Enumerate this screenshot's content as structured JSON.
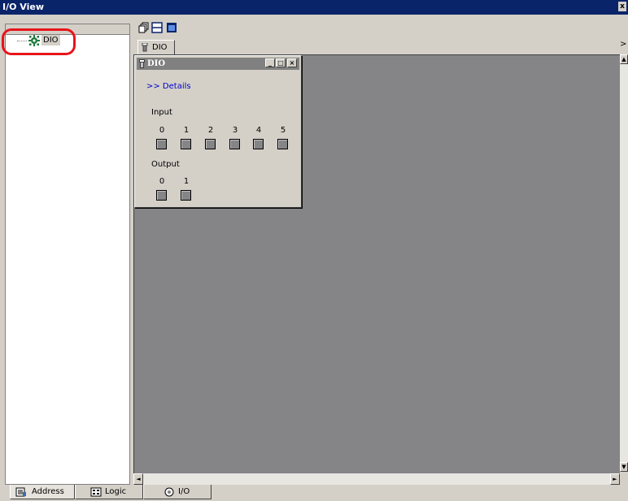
{
  "window": {
    "title": "I/O View",
    "close_glyph": "x"
  },
  "tree": {
    "node_label": "DIO",
    "node_icon": "gear-icon",
    "highlight_color": "#e8141b"
  },
  "toolbar": {
    "icons": [
      "cascade-windows-icon",
      "tile-horizontal-icon",
      "window-icon"
    ]
  },
  "document_tab": {
    "label": "DIO",
    "scroll_glyph": ">"
  },
  "dio_window": {
    "title": "DIO",
    "minimize_glyph": "_",
    "maximize_glyph": "□",
    "close_glyph": "×",
    "details_link": ">> Details",
    "input_label": "Input",
    "input_channels": [
      "0",
      "1",
      "2",
      "3",
      "4",
      "5"
    ],
    "output_label": "Output",
    "output_channels": [
      "0",
      "1"
    ]
  },
  "scrollbars": {
    "up_glyph": "▲",
    "down_glyph": "▼",
    "left_glyph": "◄",
    "right_glyph": "►"
  },
  "bottom_tabs": [
    {
      "label": "Address",
      "icon": "address-icon"
    },
    {
      "label": "Logic",
      "icon": "logic-icon"
    },
    {
      "label": "I/O",
      "icon": "io-icon"
    }
  ],
  "colors": {
    "workspace": "#858487",
    "titlebar": "#0a246a",
    "link": "#0000c8"
  }
}
